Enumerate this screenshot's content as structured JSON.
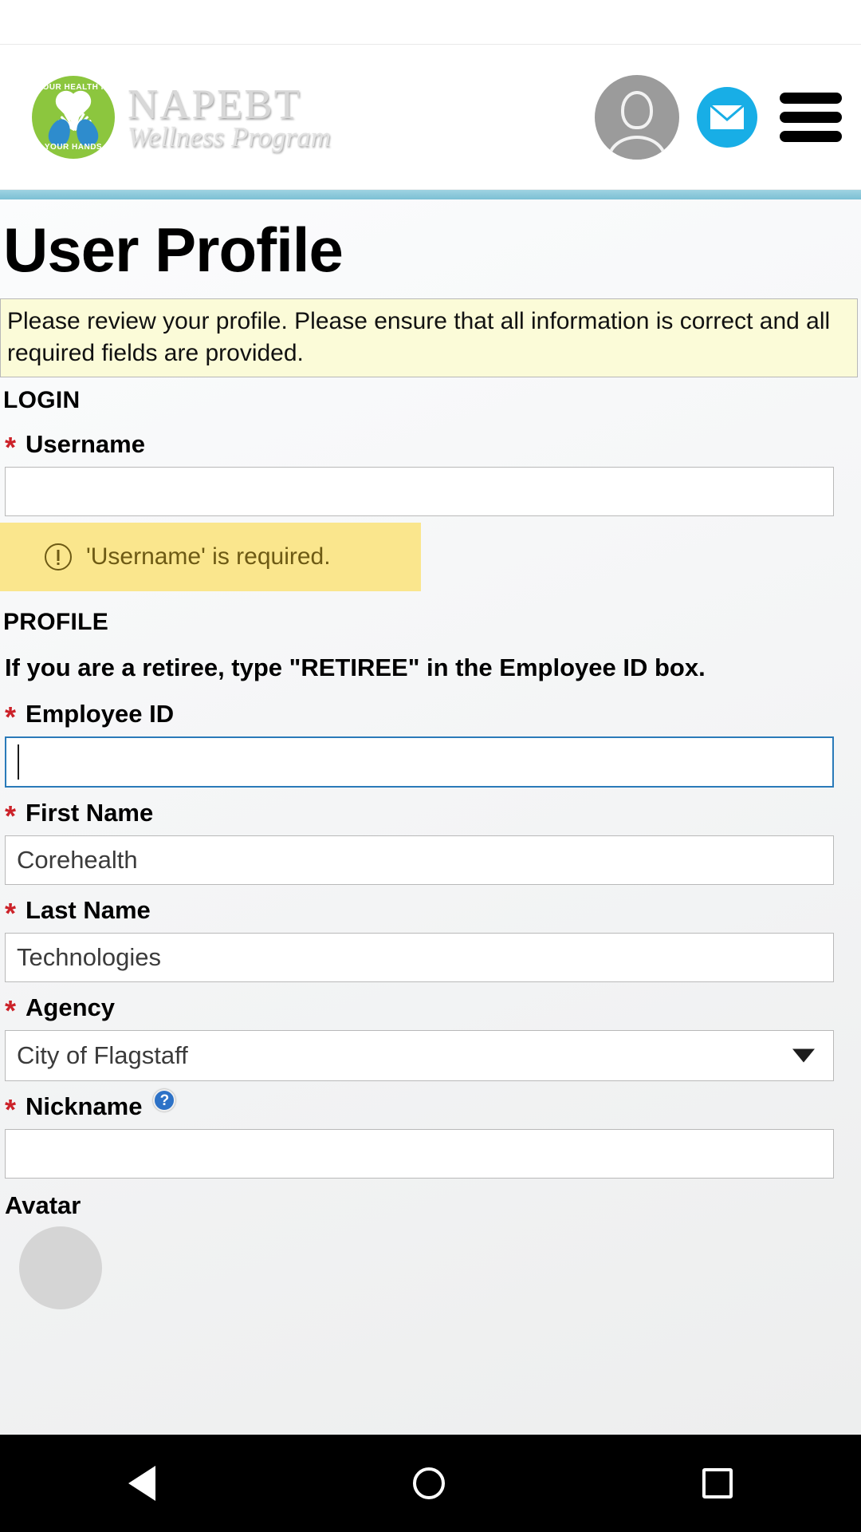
{
  "header": {
    "brand_name": "NAPEBT",
    "brand_sub": "Wellness Program",
    "badge_top_text": "YOUR HEALTH IN",
    "badge_bottom_text": "YOUR HANDS",
    "avatar_icon": "user-avatar-icon",
    "mail_icon": "mail-icon",
    "menu_icon": "hamburger-menu-icon"
  },
  "page": {
    "title": "User Profile",
    "info_banner": "Please review your profile. Please ensure that all information is correct and all required fields are provided."
  },
  "login_section": {
    "heading": "LOGIN",
    "username": {
      "label": "Username",
      "required_marker": "*",
      "value": "",
      "placeholder": ""
    },
    "validation": {
      "icon": "warning-circle-icon",
      "message": "'Username' is required."
    }
  },
  "profile_section": {
    "heading": "PROFILE",
    "retiree_note": "If you are a retiree, type \"RETIREE\" in the Employee ID box.",
    "employee_id": {
      "label": "Employee ID",
      "required_marker": "*",
      "value": "",
      "placeholder": "",
      "focused": true
    },
    "first_name": {
      "label": "First Name",
      "required_marker": "*",
      "value": "Corehealth",
      "placeholder": ""
    },
    "last_name": {
      "label": "Last Name",
      "required_marker": "*",
      "value": "Technologies",
      "placeholder": ""
    },
    "agency": {
      "label": "Agency",
      "required_marker": "*",
      "selected": "City of Flagstaff"
    },
    "nickname": {
      "label": "Nickname",
      "required_marker": "*",
      "help_icon": "help-question-icon",
      "help_glyph": "?",
      "value": "",
      "placeholder": ""
    },
    "avatar": {
      "label": "Avatar"
    }
  },
  "nav_bar": {
    "back_icon": "back-triangle-icon",
    "home_icon": "home-circle-icon",
    "recents_icon": "recents-square-icon"
  },
  "colors": {
    "brand_green": "#8cc63e",
    "brand_blue": "#2e8ccd",
    "mail_blue": "#18aee6",
    "teal_bar": "#7cc0d4",
    "required_red": "#cc2229",
    "info_banner_bg": "#fbfbd8",
    "validation_bg": "#fae68d",
    "validation_text": "#6d5a14",
    "focus_border": "#2a7ab9"
  }
}
